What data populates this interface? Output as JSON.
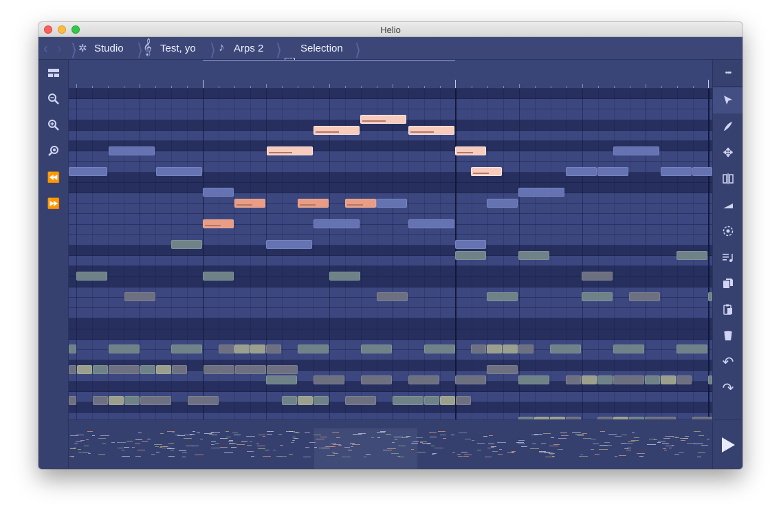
{
  "window": {
    "title": "Helio"
  },
  "breadcrumbs": [
    {
      "label": "Studio",
      "icon": "gear-icon",
      "glyph": "✲"
    },
    {
      "label": "Test, yo",
      "icon": "treble-clef-icon",
      "glyph": "𝄞"
    },
    {
      "label": "Arps 2",
      "icon": "music-note-icon",
      "glyph": "♪"
    },
    {
      "label": "Selection",
      "icon": "selection-icon"
    }
  ],
  "left_toolbar": [
    {
      "name": "toggle-layout-button",
      "icon": "layout-icon"
    },
    {
      "name": "zoom-out-button",
      "icon": "zoom-out-icon"
    },
    {
      "name": "zoom-in-button",
      "icon": "zoom-in-icon"
    },
    {
      "name": "zoom-fit-button",
      "icon": "zoom-fit-icon"
    },
    {
      "name": "rewind-button",
      "icon": "rewind-icon",
      "glyph": "⏪"
    },
    {
      "name": "fast-forward-button",
      "icon": "fast-forward-icon",
      "glyph": "⏩"
    }
  ],
  "right_toolbar": [
    {
      "name": "more-button",
      "icon": "more-icon",
      "glyph": "•••"
    },
    {
      "name": "select-tool-button",
      "icon": "cursor-icon",
      "active": true
    },
    {
      "name": "draw-tool-button",
      "icon": "pen-icon"
    },
    {
      "name": "drag-tool-button",
      "icon": "move-icon",
      "glyph": "✥"
    },
    {
      "name": "cut-tool-button",
      "icon": "split-icon"
    },
    {
      "name": "velocity-tool-button",
      "icon": "ramp-icon"
    },
    {
      "name": "zoom-tool-button",
      "icon": "target-icon"
    },
    {
      "name": "arpeggiate-button",
      "icon": "arpeggio-icon"
    },
    {
      "name": "copy-button",
      "icon": "copy-icon"
    },
    {
      "name": "paste-button",
      "icon": "paste-icon"
    },
    {
      "name": "delete-button",
      "icon": "trash-icon"
    },
    {
      "name": "undo-button",
      "icon": "undo-icon",
      "glyph": "↶"
    },
    {
      "name": "redo-button",
      "icon": "redo-icon",
      "glyph": "↷"
    }
  ],
  "transport": {
    "play_icon": "play-icon"
  },
  "colors": {
    "window_bg": "#3a4577",
    "row_dark": "#262f5e",
    "row_light": "#3c4780",
    "note_selected": "#f7ccbd",
    "note_highlight": "#e99d85",
    "note_blue": "#6573b3",
    "note_gray_green": "#6f8288",
    "note_gray": "#6c7080",
    "note_olive": "#9aa08b"
  }
}
